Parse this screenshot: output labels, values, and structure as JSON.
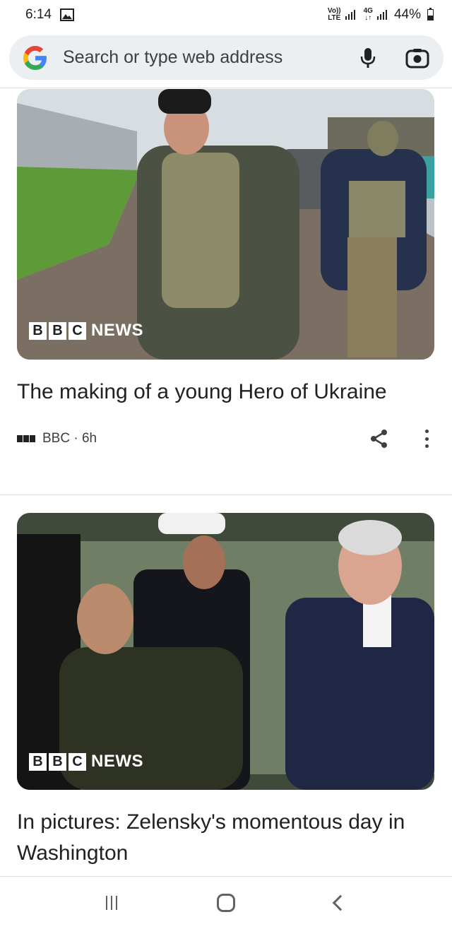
{
  "status_bar": {
    "time": "6:14",
    "volte_top": "Vo))",
    "volte_bottom": "LTE",
    "net_top": "4G",
    "net_bottom": "↓↑",
    "battery": "44%",
    "battery_level": 0.44
  },
  "search": {
    "placeholder": "Search or type web address"
  },
  "articles": [
    {
      "title": "The making of a young Hero of Ukraine",
      "source": "BBC · 6h",
      "image_logo": {
        "box1": "B",
        "box2": "B",
        "box3": "C",
        "text": "NEWS"
      }
    },
    {
      "title": "In pictures: Zelensky's momentous day in Washington",
      "image_logo": {
        "box1": "B",
        "box2": "B",
        "box3": "C",
        "text": "NEWS"
      }
    }
  ],
  "icons": {
    "gallery": "gallery-icon",
    "google": "google-logo-icon",
    "mic": "mic-icon",
    "lens": "lens-icon",
    "share": "share-icon",
    "more": "more-icon",
    "recent": "recent-apps-icon",
    "home": "home-icon",
    "back": "back-icon"
  },
  "colors": {
    "google_blue": "#4285F4",
    "google_red": "#EA4335",
    "google_yellow": "#FBBC05",
    "google_green": "#34A853",
    "searchbar_bg": "#eceff1"
  }
}
